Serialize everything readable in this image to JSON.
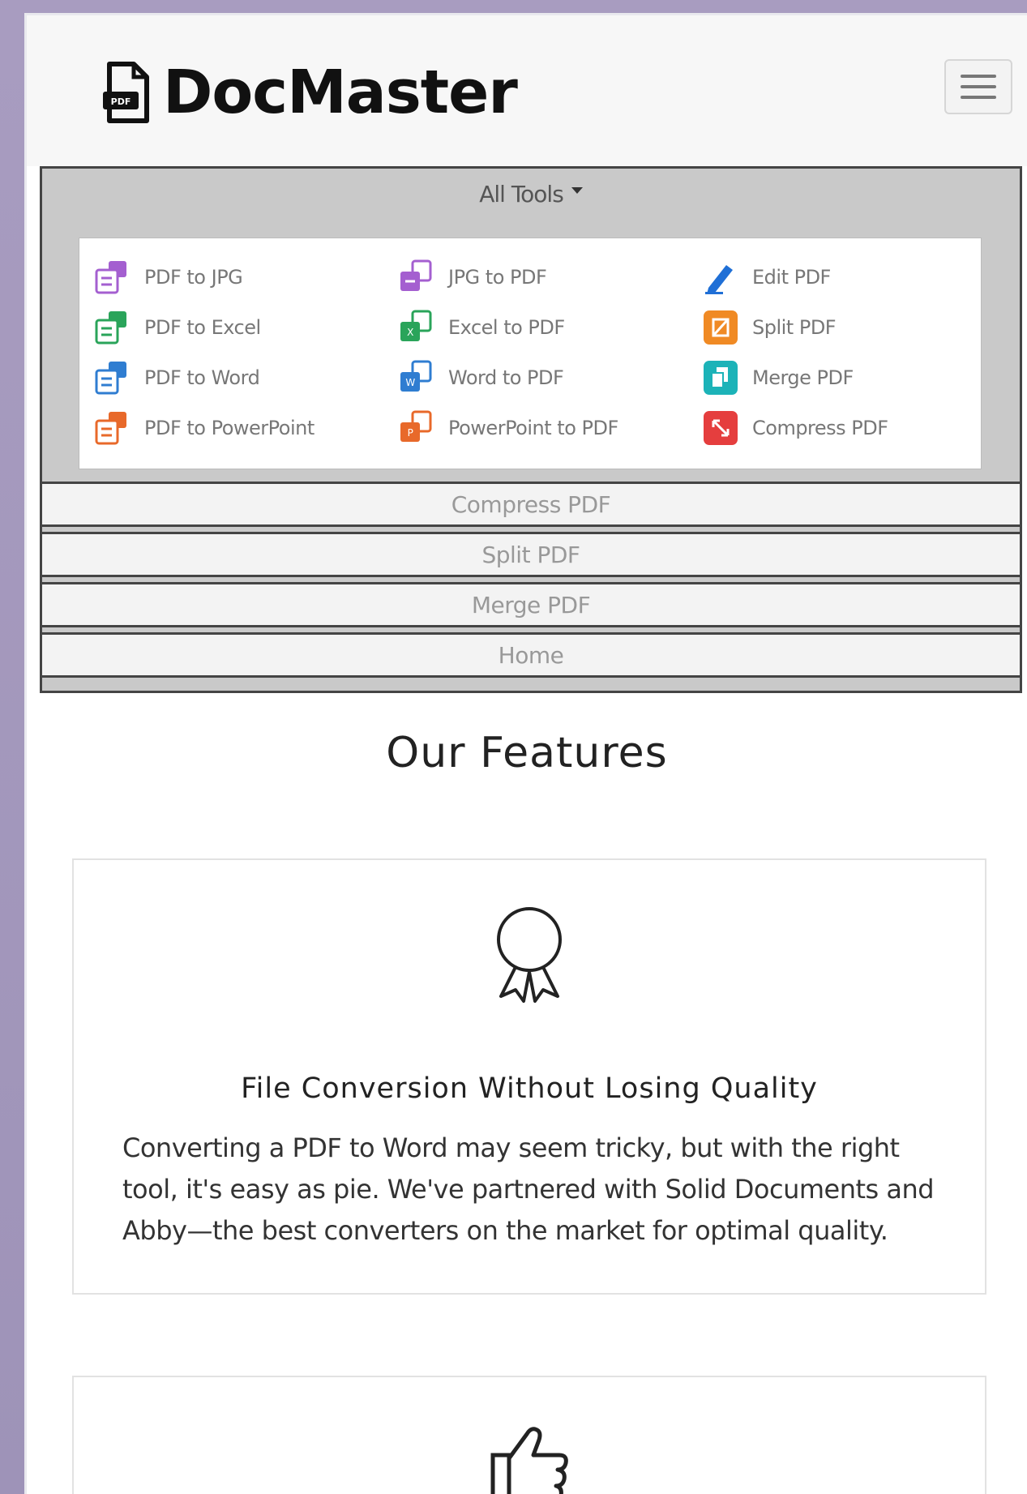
{
  "navbar": {
    "brand": "DocMaster",
    "brand_icon": "pdf-file-icon",
    "toggler_icon": "hamburger-icon"
  },
  "menu": {
    "all_tools_label": "All Tools",
    "tools": [
      {
        "label": "PDF to JPG",
        "icon": "pdf-to-jpg-icon",
        "color": "#9b4fc6"
      },
      {
        "label": "JPG to PDF",
        "icon": "jpg-to-pdf-icon",
        "color": "#9b4fc6"
      },
      {
        "label": "Edit PDF",
        "icon": "edit-pdf-icon",
        "color": "#1f6fd6"
      },
      {
        "label": "PDF to Excel",
        "icon": "pdf-to-excel-icon",
        "color": "#2aa45a"
      },
      {
        "label": "Excel to PDF",
        "icon": "excel-to-pdf-icon",
        "color": "#2aa45a"
      },
      {
        "label": "Split PDF",
        "icon": "split-pdf-icon",
        "color": "#f08a24"
      },
      {
        "label": "PDF to Word",
        "icon": "pdf-to-word-icon",
        "color": "#2f7dd1"
      },
      {
        "label": "Word to PDF",
        "icon": "word-to-pdf-icon",
        "color": "#2f7dd1"
      },
      {
        "label": "Merge PDF",
        "icon": "merge-pdf-icon",
        "color": "#1cb3b8"
      },
      {
        "label": "PDF to PowerPoint",
        "icon": "pdf-to-powerpoint-icon",
        "color": "#e8692a"
      },
      {
        "label": "PowerPoint to PDF",
        "icon": "powerpoint-to-pdf-icon",
        "color": "#e8692a"
      },
      {
        "label": "Compress PDF",
        "icon": "compress-pdf-icon",
        "color": "#e53e3e"
      }
    ],
    "links": [
      "Compress PDF",
      "Split PDF",
      "Merge PDF",
      "Home"
    ]
  },
  "features": {
    "title": "Our Features",
    "cards": [
      {
        "icon": "award-ribbon-icon",
        "title": "File Conversion Without Losing Quality",
        "text": "Converting a PDF to Word may seem tricky, but with the right tool, it's easy as pie. We've partnered with Solid Documents and Abby—the best converters on the market for optimal quality."
      },
      {
        "icon": "thumbs-up-icon"
      }
    ]
  }
}
